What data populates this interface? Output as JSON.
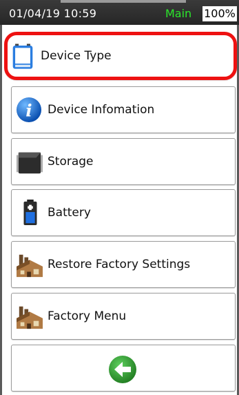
{
  "status_bar": {
    "datetime": "01/04/19 10:59",
    "mode": "Main",
    "battery": "100%"
  },
  "menu": {
    "items": [
      {
        "label": "Device Type",
        "icon": "device-icon",
        "selected": true
      },
      {
        "label": "Device Infomation",
        "icon": "info-icon"
      },
      {
        "label": "Storage",
        "icon": "storage-icon"
      },
      {
        "label": "Battery",
        "icon": "battery-icon"
      },
      {
        "label": "Restore Factory Settings",
        "icon": "factory-icon"
      },
      {
        "label": "Factory Menu",
        "icon": "factory-icon"
      }
    ],
    "back": {
      "icon": "back-arrow-icon"
    }
  },
  "colors": {
    "status_bg": "#2c2c2c",
    "mode_text": "#2be82b",
    "selection_border": "#ee1111",
    "back_button": "#2e8b2e"
  }
}
